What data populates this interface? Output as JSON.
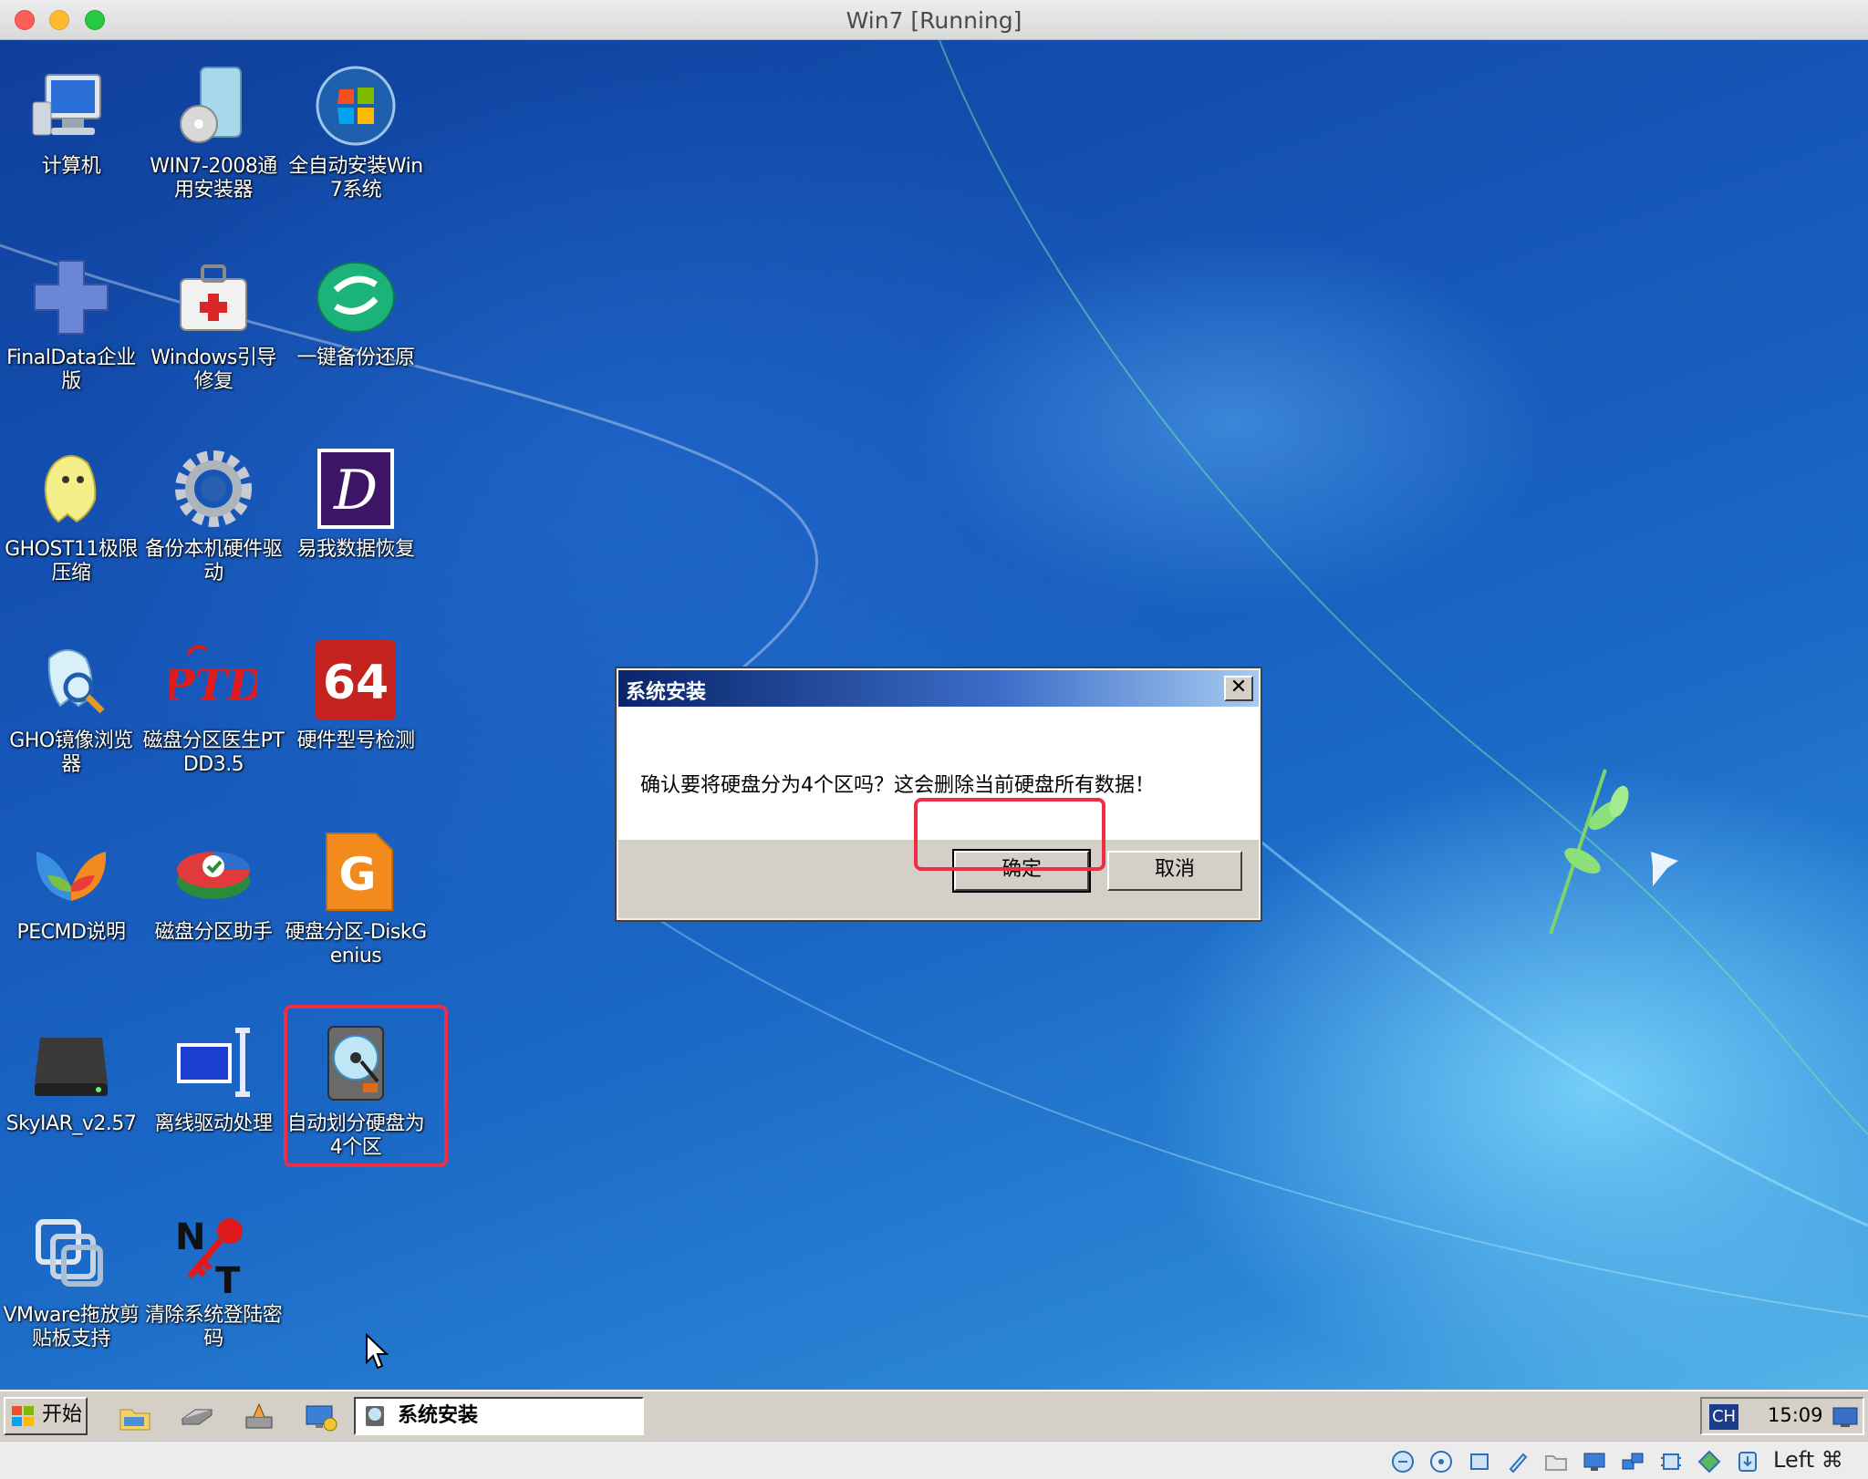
{
  "window": {
    "title": "Win7 [Running]"
  },
  "desktop": {
    "icons": [
      {
        "label": "计算机",
        "icon": "computer-icon"
      },
      {
        "label": "WIN7-2008通用安装器",
        "icon": "installer-icon"
      },
      {
        "label": "全自动安装Win7系统",
        "icon": "windows-orb-icon"
      },
      {
        "label": "FinalData企业版",
        "icon": "puzzle-cross-icon"
      },
      {
        "label": "Windows引导修复",
        "icon": "first-aid-kit-icon"
      },
      {
        "label": "一键备份还原",
        "icon": "backup-restore-icon"
      },
      {
        "label": "GHOST11极限压缩",
        "icon": "ghost-icon"
      },
      {
        "label": "备份本机硬件驱动",
        "icon": "gear-icon"
      },
      {
        "label": "易我数据恢复",
        "icon": "data-recovery-icon"
      },
      {
        "label": "GHO镜像浏览器",
        "icon": "ghost-explorer-icon"
      },
      {
        "label": "磁盘分区医生PTDD3.5",
        "icon": "ptdd-icon"
      },
      {
        "label": "硬件型号检测",
        "icon": "aida64-icon"
      },
      {
        "label": "PECMD说明",
        "icon": "msn-butterfly-icon"
      },
      {
        "label": "磁盘分区助手",
        "icon": "partition-assistant-icon"
      },
      {
        "label": "硬盘分区-DiskGenius",
        "icon": "diskgenius-icon"
      },
      {
        "label": "SkyIAR_v2.57",
        "icon": "hard-drive-icon"
      },
      {
        "label": "离线驱动处理",
        "icon": "offline-driver-icon"
      },
      {
        "label": "自动划分硬盘为4个区",
        "icon": "auto-partition-disk-icon"
      },
      {
        "label": "VMware拖放剪贴板支持",
        "icon": "vmware-icon"
      },
      {
        "label": "清除系统登陆密码",
        "icon": "nt-password-key-icon"
      }
    ]
  },
  "dialog": {
    "title": "系统安装",
    "message": "确认要将硬盘分为4个区吗？这会删除当前硬盘所有数据！",
    "ok_label": "确定",
    "cancel_label": "取消",
    "close_glyph": "✕"
  },
  "taskbar": {
    "start_label": "开始",
    "task_item_label": "系统安装",
    "tray_lang": "CH",
    "tray_time": "15:09"
  },
  "vbox_status": {
    "host_key_label": "Left ⌘"
  },
  "colors": {
    "highlight": "#ee2e45",
    "dialog_title_start": "#0a246a"
  }
}
